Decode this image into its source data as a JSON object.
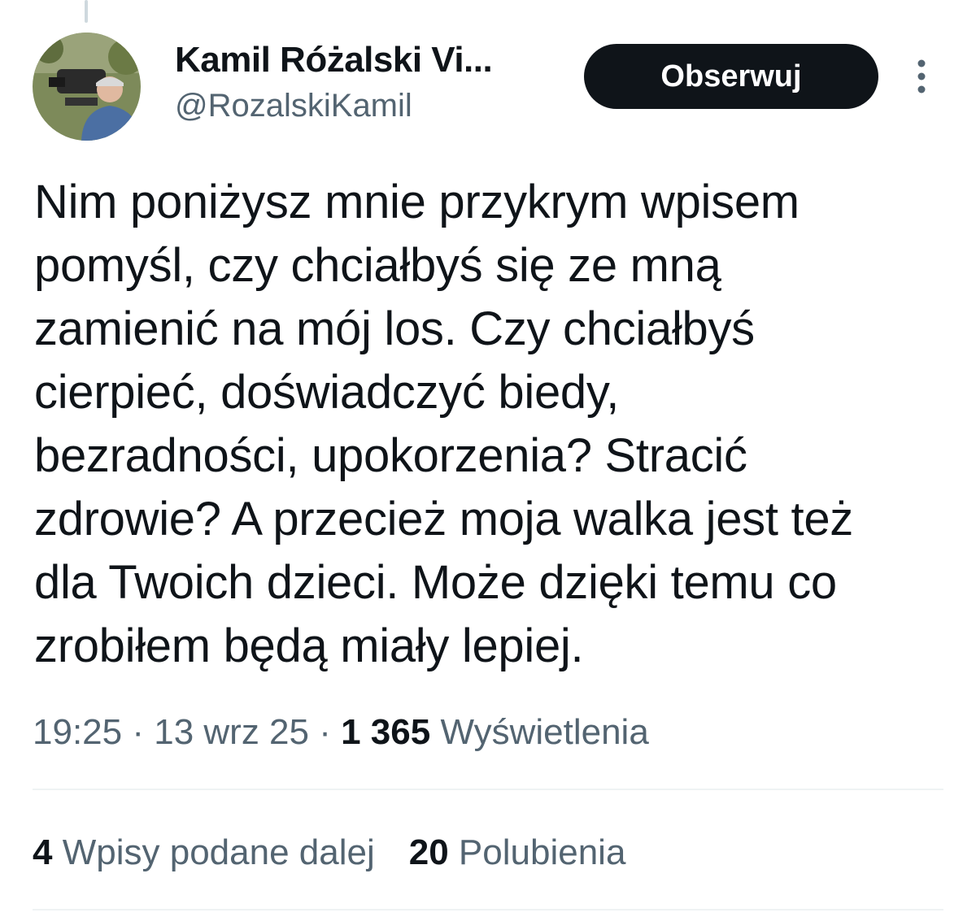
{
  "author": {
    "display_name": "Kamil Różalski Vi...",
    "handle": "@RozalskiKamil",
    "avatar": "avatar-photo"
  },
  "follow_label": "Obserwuj",
  "more_icon": "more-vertical-icon",
  "tweet": {
    "lines": [
      "Nim poniżysz mnie przykrym wpisem",
      "pomyśl, czy chciałbyś się ze mną",
      "zamienić na mój los. Czy chciałbyś",
      "cierpieć, doświadczyć biedy,",
      "bezradności, upokorzenia? Stracić",
      "zdrowie? A przecież moja walka jest też",
      "dla Twoich dzieci. Może dzięki temu co",
      "zrobiłem będą miały lepiej."
    ]
  },
  "meta": {
    "time": "19:25",
    "separator": " · ",
    "date": "13 wrz 25",
    "views_count": "1 365",
    "views_label": "Wyświetlenia"
  },
  "stats": {
    "reposts_count": "4",
    "reposts_label": "Wpisy podane dalej",
    "likes_count": "20",
    "likes_label": "Polubienia"
  },
  "colors": {
    "text": "#0f1419",
    "secondary": "#536471",
    "divider": "#eff3f4",
    "button_bg": "#0f1419"
  }
}
